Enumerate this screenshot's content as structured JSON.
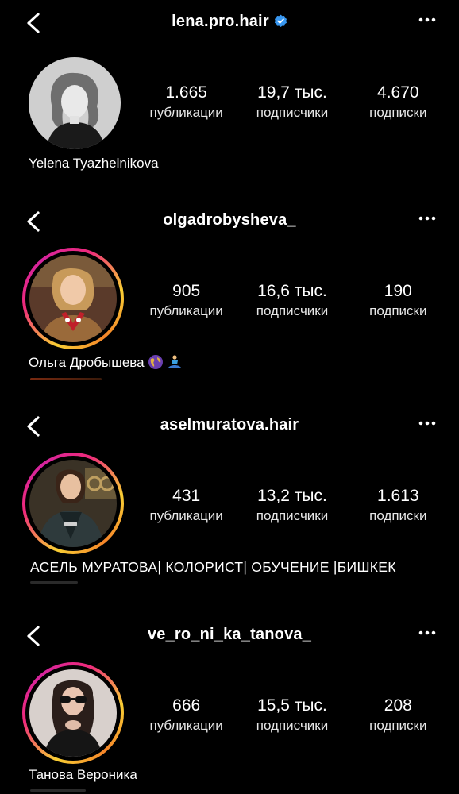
{
  "profiles": [
    {
      "username": "lena.pro.hair",
      "verified": true,
      "posts": "1.665",
      "posts_label": "публикации",
      "followers": "19,7 тыс.",
      "followers_label": "подписчики",
      "following": "4.670",
      "following_label": "подписки",
      "name": "Yelena Tyazhelnikova",
      "story_ring": false
    },
    {
      "username": "olgadrobysheva_",
      "verified": false,
      "posts": "905",
      "posts_label": "публикации",
      "followers": "16,6 тыс.",
      "followers_label": "подписчики",
      "following": "190",
      "following_label": "подписки",
      "name": "Ольга Дробышева",
      "name_icons": [
        "globe-emoji-icon",
        "meditation-emoji-icon"
      ],
      "story_ring": true
    },
    {
      "username": "aselmuratova.hair",
      "verified": false,
      "posts": "431",
      "posts_label": "публикации",
      "followers": "13,2 тыс.",
      "followers_label": "подписчики",
      "following": "1.613",
      "following_label": "подписки",
      "name": "АСЕЛЬ МУРАТОВА| КОЛОРИСТ| ОБУЧЕНИЕ |БИШКЕК",
      "story_ring": true
    },
    {
      "username": "ve_ro_ni_ka_tanova_",
      "verified": false,
      "posts": "666",
      "posts_label": "публикации",
      "followers": "15,5 тыс.",
      "followers_label": "подписчики",
      "following": "208",
      "following_label": "подписки",
      "name": "Танова Вероника",
      "story_ring": true
    }
  ],
  "icons": {
    "back": "chevron-left-icon",
    "more": "more-horizontal-icon",
    "verified": "verified-badge-icon"
  },
  "colors": {
    "background": "#000000",
    "text": "#ffffff",
    "verified": "#3897f0",
    "ring_start": "#f9ce34",
    "ring_mid": "#ee2a7b",
    "ring_end": "#d6249f"
  }
}
